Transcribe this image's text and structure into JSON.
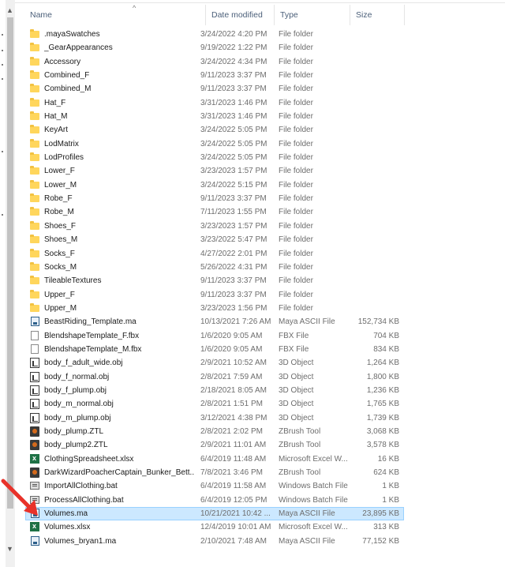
{
  "columns": {
    "name": "Name",
    "date": "Date modified",
    "type": "Type",
    "size": "Size"
  },
  "files": [
    {
      "name": ".mayaSwatches",
      "date": "3/24/2022 4:20 PM",
      "type": "File folder",
      "size": "",
      "icon": "folder-icon"
    },
    {
      "name": "_GearAppearances",
      "date": "9/19/2022 1:22 PM",
      "type": "File folder",
      "size": "",
      "icon": "folder-icon"
    },
    {
      "name": "Accessory",
      "date": "3/24/2022 4:34 PM",
      "type": "File folder",
      "size": "",
      "icon": "folder-icon"
    },
    {
      "name": "Combined_F",
      "date": "9/11/2023 3:37 PM",
      "type": "File folder",
      "size": "",
      "icon": "folder-icon"
    },
    {
      "name": "Combined_M",
      "date": "9/11/2023 3:37 PM",
      "type": "File folder",
      "size": "",
      "icon": "folder-icon"
    },
    {
      "name": "Hat_F",
      "date": "3/31/2023 1:46 PM",
      "type": "File folder",
      "size": "",
      "icon": "folder-icon"
    },
    {
      "name": "Hat_M",
      "date": "3/31/2023 1:46 PM",
      "type": "File folder",
      "size": "",
      "icon": "folder-icon"
    },
    {
      "name": "KeyArt",
      "date": "3/24/2022 5:05 PM",
      "type": "File folder",
      "size": "",
      "icon": "folder-icon"
    },
    {
      "name": "LodMatrix",
      "date": "3/24/2022 5:05 PM",
      "type": "File folder",
      "size": "",
      "icon": "folder-icon"
    },
    {
      "name": "LodProfiles",
      "date": "3/24/2022 5:05 PM",
      "type": "File folder",
      "size": "",
      "icon": "folder-icon"
    },
    {
      "name": "Lower_F",
      "date": "3/23/2023 1:57 PM",
      "type": "File folder",
      "size": "",
      "icon": "folder-icon"
    },
    {
      "name": "Lower_M",
      "date": "3/24/2022 5:15 PM",
      "type": "File folder",
      "size": "",
      "icon": "folder-icon"
    },
    {
      "name": "Robe_F",
      "date": "9/11/2023 3:37 PM",
      "type": "File folder",
      "size": "",
      "icon": "folder-icon"
    },
    {
      "name": "Robe_M",
      "date": "7/11/2023 1:55 PM",
      "type": "File folder",
      "size": "",
      "icon": "folder-icon"
    },
    {
      "name": "Shoes_F",
      "date": "3/23/2023 1:57 PM",
      "type": "File folder",
      "size": "",
      "icon": "folder-icon"
    },
    {
      "name": "Shoes_M",
      "date": "3/23/2022 5:47 PM",
      "type": "File folder",
      "size": "",
      "icon": "folder-icon"
    },
    {
      "name": "Socks_F",
      "date": "4/27/2022 2:01 PM",
      "type": "File folder",
      "size": "",
      "icon": "folder-icon"
    },
    {
      "name": "Socks_M",
      "date": "5/26/2022 4:31 PM",
      "type": "File folder",
      "size": "",
      "icon": "folder-icon"
    },
    {
      "name": "TileableTextures",
      "date": "9/11/2023 3:37 PM",
      "type": "File folder",
      "size": "",
      "icon": "folder-icon"
    },
    {
      "name": "Upper_F",
      "date": "9/11/2023 3:37 PM",
      "type": "File folder",
      "size": "",
      "icon": "folder-icon"
    },
    {
      "name": "Upper_M",
      "date": "3/23/2023 1:56 PM",
      "type": "File folder",
      "size": "",
      "icon": "folder-icon"
    },
    {
      "name": "BeastRiding_Template.ma",
      "date": "10/13/2021 7:26 AM",
      "type": "Maya ASCII File",
      "size": "152,734 KB",
      "icon": "maya-file-icon"
    },
    {
      "name": "BlendshapeTemplate_F.fbx",
      "date": "1/6/2020 9:05 AM",
      "type": "FBX File",
      "size": "704 KB",
      "icon": "fbx-file-icon"
    },
    {
      "name": "BlendshapeTemplate_M.fbx",
      "date": "1/6/2020 9:05 AM",
      "type": "FBX File",
      "size": "834 KB",
      "icon": "fbx-file-icon"
    },
    {
      "name": "body_f_adult_wide.obj",
      "date": "2/9/2021 10:52 AM",
      "type": "3D Object",
      "size": "1,264 KB",
      "icon": "3d-object-icon"
    },
    {
      "name": "body_f_normal.obj",
      "date": "2/8/2021 7:59 AM",
      "type": "3D Object",
      "size": "1,800 KB",
      "icon": "3d-object-icon"
    },
    {
      "name": "body_f_plump.obj",
      "date": "2/18/2021 8:05 AM",
      "type": "3D Object",
      "size": "1,236 KB",
      "icon": "3d-object-icon"
    },
    {
      "name": "body_m_normal.obj",
      "date": "2/8/2021 1:51 PM",
      "type": "3D Object",
      "size": "1,765 KB",
      "icon": "3d-object-icon"
    },
    {
      "name": "body_m_plump.obj",
      "date": "3/12/2021 4:38 PM",
      "type": "3D Object",
      "size": "1,739 KB",
      "icon": "3d-object-icon"
    },
    {
      "name": "body_plump.ZTL",
      "date": "2/8/2021 2:02 PM",
      "type": "ZBrush Tool",
      "size": "3,068 KB",
      "icon": "zbrush-file-icon"
    },
    {
      "name": "body_plump2.ZTL",
      "date": "2/9/2021 11:01 AM",
      "type": "ZBrush Tool",
      "size": "3,578 KB",
      "icon": "zbrush-file-icon"
    },
    {
      "name": "ClothingSpreadsheet.xlsx",
      "date": "6/4/2019 11:48 AM",
      "type": "Microsoft Excel W...",
      "size": "16 KB",
      "icon": "excel-file-icon"
    },
    {
      "name": "DarkWizardPoacherCaptain_Bunker_Bett...",
      "date": "7/8/2021 3:46 PM",
      "type": "ZBrush Tool",
      "size": "624 KB",
      "icon": "zbrush-file-icon"
    },
    {
      "name": "ImportAllClothing.bat",
      "date": "6/4/2019 11:58 AM",
      "type": "Windows Batch File",
      "size": "1 KB",
      "icon": "batch-file-icon"
    },
    {
      "name": "ProcessAllClothing.bat",
      "date": "6/4/2019 12:05 PM",
      "type": "Windows Batch File",
      "size": "1 KB",
      "icon": "batch-file-icon"
    },
    {
      "name": "Volumes.ma",
      "date": "10/21/2021 10:42 ...",
      "type": "Maya ASCII File",
      "size": "23,895 KB",
      "icon": "maya-file-icon",
      "selected": true
    },
    {
      "name": "Volumes.xlsx",
      "date": "12/4/2019 10:01 AM",
      "type": "Microsoft Excel W...",
      "size": "313 KB",
      "icon": "excel-file-icon"
    },
    {
      "name": "Volumes_bryan1.ma",
      "date": "2/10/2021 7:48 AM",
      "type": "Maya ASCII File",
      "size": "77,152 KB",
      "icon": "maya-file-icon"
    }
  ],
  "colors": {
    "selection": "#cce8ff",
    "selection_border": "#99d1ff",
    "header_text": "#4c607a",
    "annotation_arrow": "#e8322a"
  }
}
